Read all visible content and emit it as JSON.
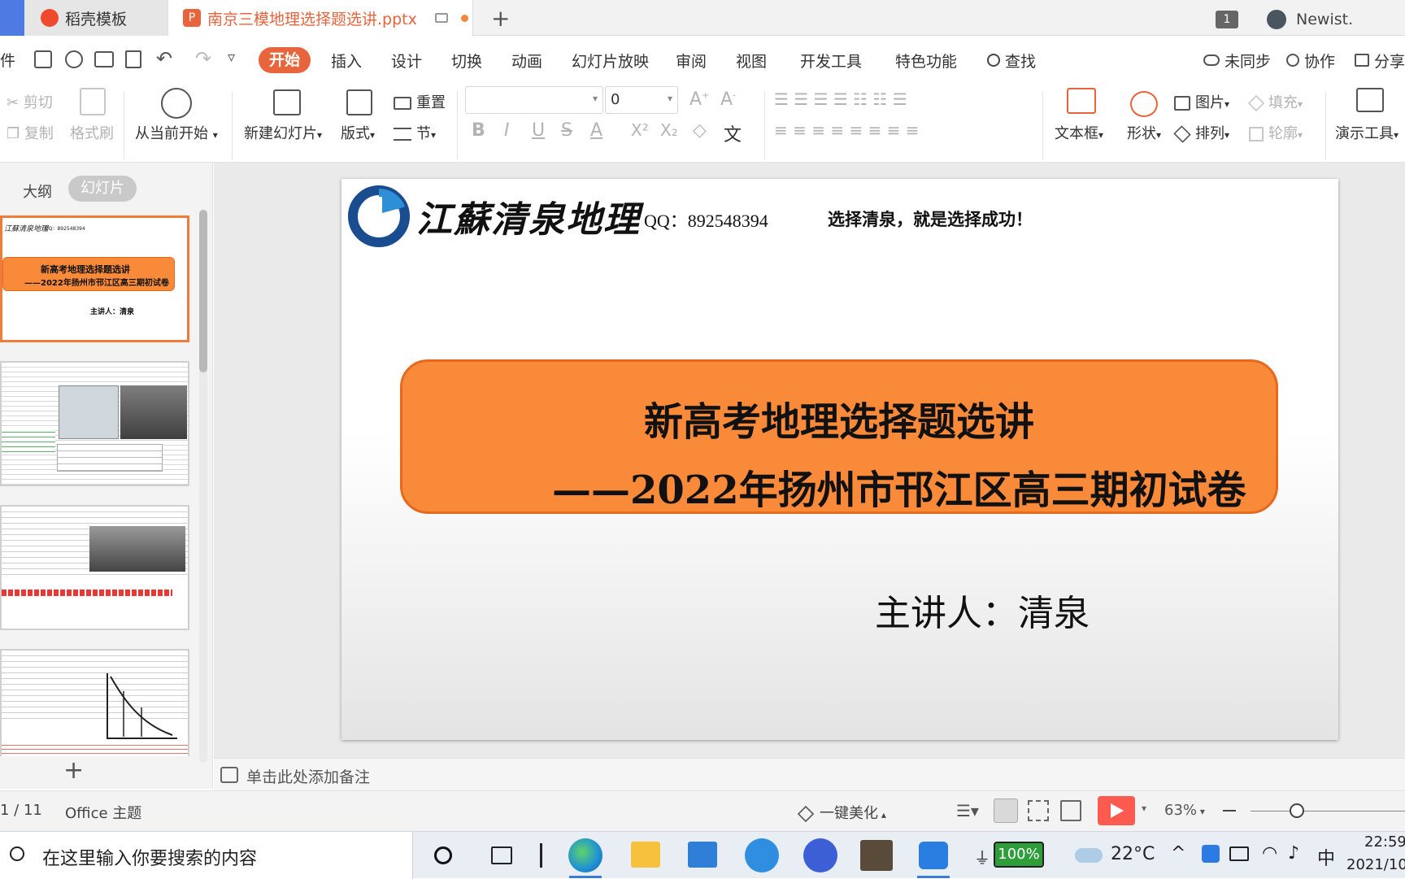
{
  "titlebar": {
    "tab1": "稻壳模板",
    "tab2": "南京三模地理选择题选讲.pptx",
    "new_tab": "+",
    "page_count": "1",
    "user": "Newist."
  },
  "menubar": {
    "left_cut": "件",
    "items": [
      "开始",
      "插入",
      "设计",
      "切换",
      "动画",
      "幻灯片放映",
      "审阅",
      "视图",
      "开发工具",
      "特色功能"
    ],
    "search": "查找",
    "right": [
      "未同步",
      "协作",
      "分享"
    ]
  },
  "ribbon": {
    "cut": "剪切",
    "copy": "复制",
    "format_painter": "格式刷",
    "from_current": "从当前开始",
    "new_slide": "新建幻灯片",
    "layout": "版式",
    "reset": "重置",
    "section": "节",
    "font_size": "0",
    "textbox": "文本框",
    "shape": "形状",
    "picture": "图片",
    "arrange": "排列",
    "fill": "填充",
    "outline": "轮廓",
    "presenter": "演示工具",
    "bold": "B",
    "italic": "I",
    "underline": "U",
    "strike": "S",
    "font_color": "A"
  },
  "leftpanel": {
    "tab_outline": "大纲",
    "tab_slides": "幻灯片",
    "add": "+"
  },
  "slide": {
    "brand": "江蘇清泉地理",
    "qq": "QQ：892548394",
    "slogan": "选择清泉，就是选择成功！",
    "title": "新高考地理选择题选讲",
    "subtitle": "——2022年扬州市邗江区高三期初试卷",
    "speaker": "主讲人：清泉"
  },
  "thumb1": {
    "title": "新高考地理选择题选讲",
    "subtitle": "——2022年扬州市邗江区高三期初试卷",
    "speaker": "主讲人：清泉",
    "brand": "江蘇清泉地理",
    "qq": "QQ：892548394"
  },
  "notes": {
    "placeholder": "单击此处添加备注"
  },
  "status": {
    "page": "1 / 11",
    "theme": "Office 主题",
    "beautify": "一键美化",
    "zoom": "63%"
  },
  "taskbar": {
    "search": "在这里输入你要搜索的内容",
    "battery": "100%",
    "weather": "22°C",
    "ime": "中",
    "time": "22:59",
    "date": "2021/10"
  },
  "colors": {
    "accent": "#e8643c",
    "slide_box": "#f98a3a",
    "slide_box_border": "#e5691e",
    "wps_red": "#ff5a4f"
  }
}
